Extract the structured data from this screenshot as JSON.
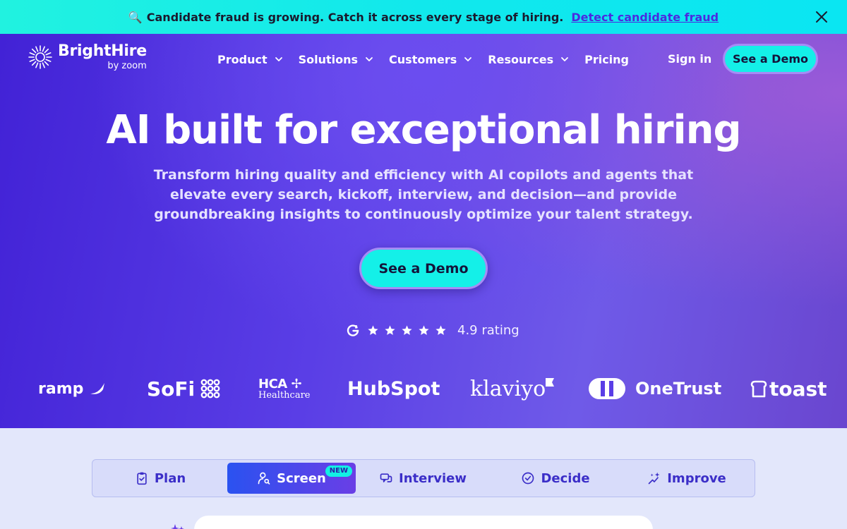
{
  "announcement": {
    "emoji": "🔍",
    "text": "Candidate fraud is growing. Catch it across every stage of hiring.",
    "link": "Detect candidate fraud"
  },
  "brand": {
    "name": "BrightHire",
    "sub": "by zoom"
  },
  "nav": {
    "items": [
      {
        "label": "Product",
        "dropdown": true
      },
      {
        "label": "Solutions",
        "dropdown": true
      },
      {
        "label": "Customers",
        "dropdown": true
      },
      {
        "label": "Resources",
        "dropdown": true
      },
      {
        "label": "Pricing",
        "dropdown": false
      }
    ],
    "signin": "Sign in",
    "demo": "See a Demo"
  },
  "hero": {
    "headline": "AI built for exceptional hiring",
    "subhead": "Transform hiring quality and efficiency with AI copilots and agents that elevate every search, kickoff, interview, and decision—and provide groundbreaking insights to continuously optimize your talent strategy.",
    "cta": "See a Demo",
    "rating_stars": 5,
    "rating": "4.9 rating"
  },
  "customer_logos": [
    "ramp",
    "SoFi",
    "HCA",
    "Healthcare",
    "HubSpot",
    "klaviyo",
    "OneTrust",
    "toast"
  ],
  "tabs": [
    {
      "label": "Plan",
      "icon": "clipboard-check-icon",
      "active": false
    },
    {
      "label": "Screen",
      "icon": "user-search-icon",
      "active": true,
      "badge": "NEW"
    },
    {
      "label": "Interview",
      "icon": "chat-bubbles-icon",
      "active": false
    },
    {
      "label": "Decide",
      "icon": "check-circle-icon",
      "active": false
    },
    {
      "label": "Improve",
      "icon": "sparkle-trend-icon",
      "active": false
    }
  ],
  "colors": {
    "announcement_bg": "#14ECEA",
    "accent_cyan": "#14F0E8",
    "hero_purple": "#4C2EDD",
    "tab_text": "#3B2EC8"
  }
}
